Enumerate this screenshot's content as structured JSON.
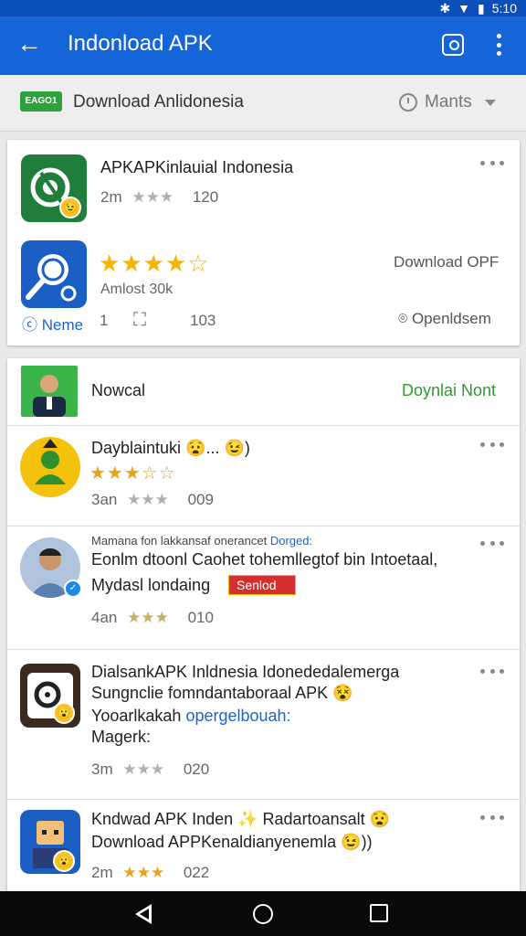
{
  "status_bar": {
    "time": "5:10"
  },
  "app_bar": {
    "title": "Indonload APK"
  },
  "filter_bar": {
    "logo_text": "EAGO1",
    "label": "Download Anlidonesia",
    "sort_label": "Mants"
  },
  "featured": [
    {
      "title": "APKAPKinlauial Indonesia",
      "age": "2m",
      "stars": "★★★",
      "count": "120",
      "icon_bg": "#1f7f3a"
    },
    {
      "rating_stars": "★★★★☆",
      "action": "Download OPF",
      "info": "Amlost 30k",
      "icon_bg": "#1c5fc4"
    }
  ],
  "featured_footer": {
    "link": "Neme",
    "num1": "1",
    "num2": "103",
    "right_label": "Openldsem"
  },
  "header_item": {
    "title": "Nowcal",
    "action": "Doynlai Nont"
  },
  "list": [
    {
      "title": "Dayblaintuki 😧... 😉)",
      "rating": "★★★☆☆",
      "age": "3an",
      "stars": "★★★",
      "count": "009"
    },
    {
      "kicker": "Mamana fon lakkansaf onerancet",
      "kicker_link": "Dorged:",
      "title": "Eonlm dtoonl Caohet tohemllegtof bin Intoetaal,",
      "line2": "Mydasl londaing",
      "tag": "Senlod",
      "age": "4an",
      "stars": "★★★",
      "count": "010"
    },
    {
      "title": "DialsankAPK Inldnesia Idonededalemerga",
      "line2": "Sungnclie fomndantaboraal APK 😵",
      "line3_prefix": "Yooarlkakah",
      "line3_link": "opergelbouah:",
      "line4": "Magerk:",
      "age": "3m",
      "stars": "★★★",
      "count": "020"
    },
    {
      "title": "Kndwad APK Inden ✨ Radartoansalt 😧",
      "line2": "Download APPKenaldianyenemla 😉))",
      "age": "2m",
      "stars": "★★★",
      "count": "022"
    }
  ],
  "colors": {
    "app_bar": "#1565d8",
    "status_bar": "#0d4fb8",
    "accent_green": "#2e9a2e",
    "link_blue": "#1565d8",
    "star_gold": "#f4b400",
    "star_gray": "#b0b0b0"
  }
}
